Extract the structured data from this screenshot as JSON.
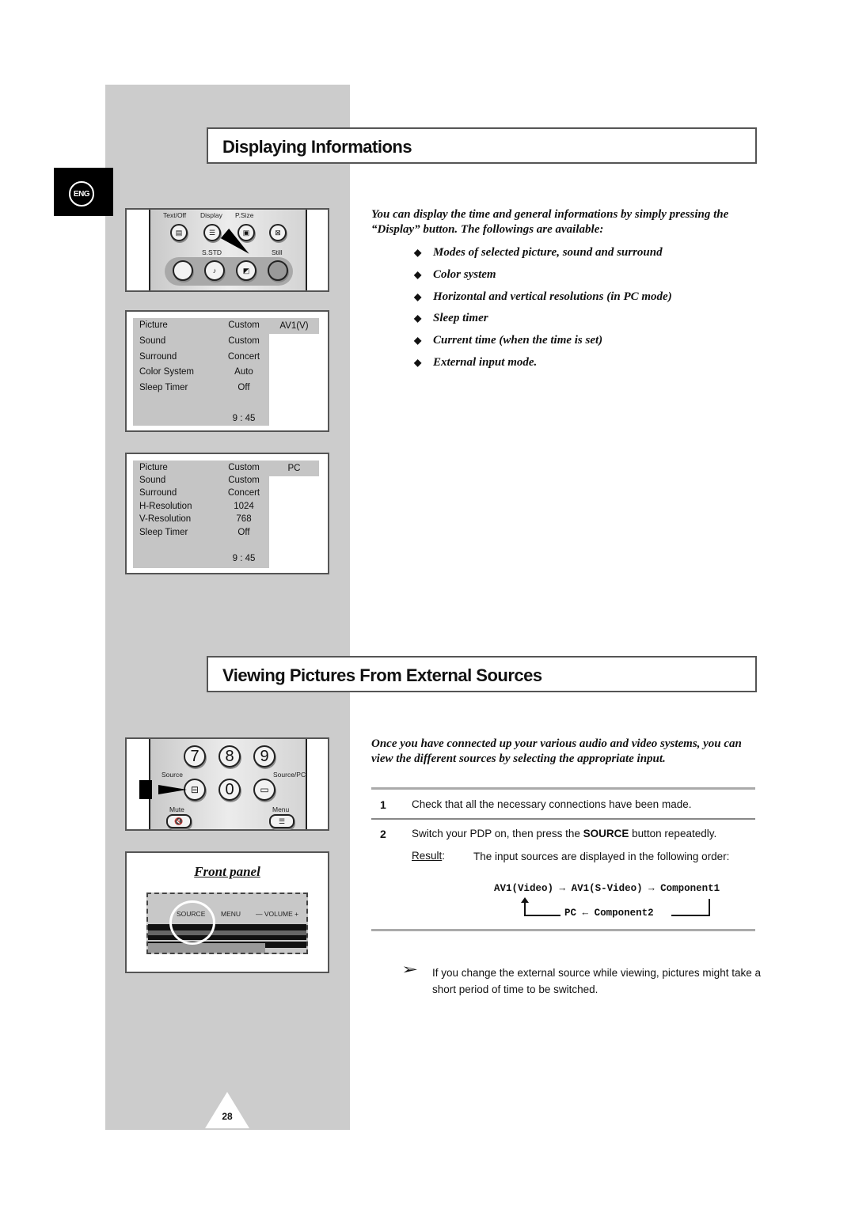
{
  "page": {
    "language_badge": "ENG",
    "page_number": "28"
  },
  "section1": {
    "title": "Displaying Informations",
    "remote": {
      "labels": {
        "text_off": "Text/Off",
        "display": "Display",
        "psize": "P.Size",
        "sstd": "S.STD",
        "still": "Still"
      },
      "icons": [
        "text-off-icon",
        "display-icon",
        "psize-icon",
        "text-exit-icon",
        "blank-button",
        "sound-mode-icon",
        "picture-mode-icon",
        "still-button"
      ]
    },
    "osd_av": {
      "source": "AV1(V)",
      "rows": [
        {
          "key": "Picture",
          "value": "Custom"
        },
        {
          "key": "Sound",
          "value": "Custom"
        },
        {
          "key": "Surround",
          "value": "Concert"
        },
        {
          "key": "Color System",
          "value": "Auto"
        },
        {
          "key": "Sleep Timer",
          "value": "Off"
        }
      ],
      "time": "9 : 45"
    },
    "osd_pc": {
      "source": "PC",
      "rows": [
        {
          "key": "Picture",
          "value": "Custom"
        },
        {
          "key": "Sound",
          "value": "Custom"
        },
        {
          "key": "Surround",
          "value": "Concert"
        },
        {
          "key": "H-Resolution",
          "value": "1024"
        },
        {
          "key": "V-Resolution",
          "value": "768"
        },
        {
          "key": "Sleep Timer",
          "value": "Off"
        }
      ],
      "time": "9 : 45"
    },
    "intro": "You can display the time and general informations by simply pressing the “Display” button. The followings are available:",
    "bullets": [
      "Modes of selected picture, sound and surround",
      "Color system",
      "Horizontal and vertical resolutions (in PC mode)",
      "Sleep timer",
      "Current time (when the time is set)",
      "External input mode."
    ]
  },
  "section2": {
    "title": "Viewing Pictures From External Sources",
    "remote": {
      "digits": [
        "7",
        "8",
        "9",
        "0"
      ],
      "labels": {
        "source": "Source",
        "source_pc": "Source/PC",
        "mute": "Mute",
        "menu": "Menu"
      }
    },
    "front_panel": {
      "caption": "Front panel",
      "labels": {
        "source": "SOURCE",
        "menu": "MENU",
        "volume": "— VOLUME +"
      }
    },
    "intro": "Once you have connected up your various audio and video systems, you can view the different sources by selecting the appropriate input.",
    "steps": [
      {
        "num": "1",
        "text": "Check that all the necessary connections have been made."
      },
      {
        "num": "2",
        "text_before": "Switch your PDP on, then press the ",
        "bold": "SOURCE",
        "text_after": " button repeatedly."
      }
    ],
    "result_label": "Result",
    "result_text": "The input sources are displayed in the following order:",
    "sequence": {
      "top": [
        "AV1(Video)",
        "AV1(S-Video)",
        "Component1"
      ],
      "bottom": [
        "PC",
        "Component2"
      ],
      "arrow_right": "→",
      "arrow_left": "←"
    },
    "note_icon": "pointer-arrow-icon",
    "note": "If you change the external source while viewing, pictures might take a short period of time to be switched."
  }
}
